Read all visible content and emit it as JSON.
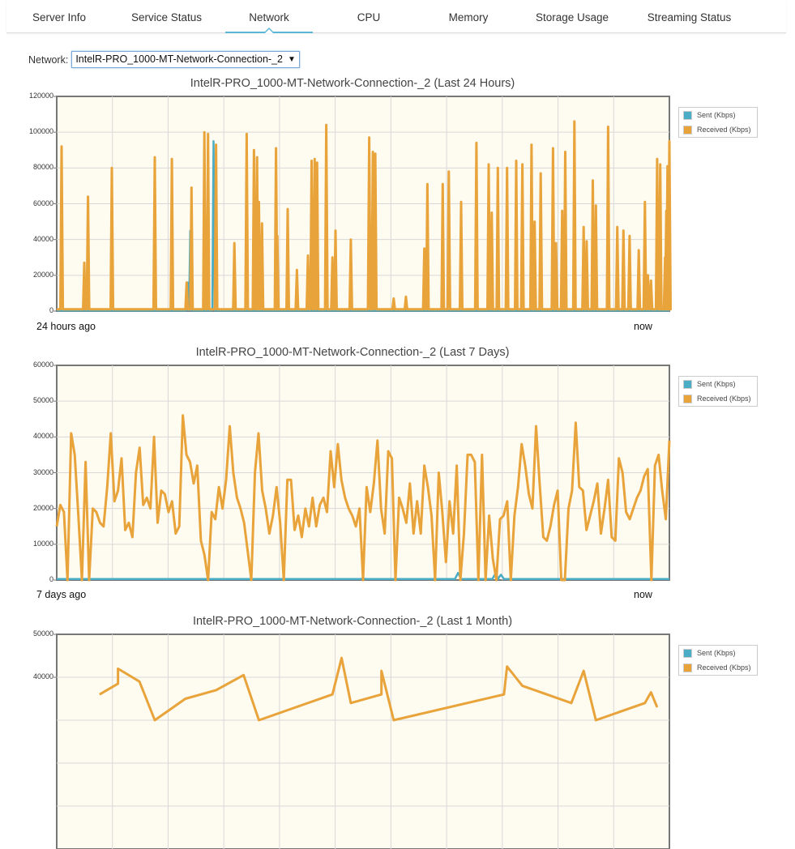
{
  "tabs": [
    {
      "label": "Server Info",
      "active": false
    },
    {
      "label": "Service Status",
      "active": false
    },
    {
      "label": "Network",
      "active": true
    },
    {
      "label": "CPU",
      "active": false
    },
    {
      "label": "Memory",
      "active": false
    },
    {
      "label": "Storage Usage",
      "active": false
    },
    {
      "label": "Streaming Status",
      "active": false
    }
  ],
  "network_selector": {
    "label": "Network:",
    "value": "IntelR-PRO_1000-MT-Network-Connection-_2"
  },
  "legend": {
    "sent": "Sent (Kbps)",
    "received": "Received (Kbps)"
  },
  "colors": {
    "sent": "#4bacc6",
    "received": "#e8a33a",
    "plot_bg": "#fefcf0",
    "grid": "#d8d8d8",
    "tab_accent": "#5ab6d4"
  },
  "chart_data": [
    {
      "type": "line",
      "title": "IntelR-PRO_1000-MT-Network-Connection-_2 (Last 24 Hours)",
      "start_label": "24 hours ago",
      "end_label": "now",
      "ylim": [
        0,
        120000
      ],
      "yticks": [
        0,
        20000,
        40000,
        60000,
        80000,
        100000,
        120000
      ],
      "grid": true,
      "legend_position": "right",
      "series": [
        {
          "name": "Sent (Kbps)",
          "key": "sent",
          "spikes": [
            [
              0.214,
              16000
            ],
            [
              0.218,
              45000
            ],
            [
              0.256,
              95000
            ]
          ],
          "baseline": 300
        },
        {
          "name": "Received (Kbps)",
          "key": "received",
          "baseline": 1000,
          "spikes": [
            [
              0.008,
              92000
            ],
            [
              0.045,
              27000
            ],
            [
              0.051,
              64000
            ],
            [
              0.09,
              80000
            ],
            [
              0.16,
              86000
            ],
            [
              0.188,
              85000
            ],
            [
              0.212,
              16000
            ],
            [
              0.22,
              69000
            ],
            [
              0.241,
              100000
            ],
            [
              0.247,
              99000
            ],
            [
              0.26,
              93000
            ],
            [
              0.29,
              38000
            ],
            [
              0.31,
              99000
            ],
            [
              0.322,
              90000
            ],
            [
              0.327,
              86000
            ],
            [
              0.33,
              61000
            ],
            [
              0.335,
              49000
            ],
            [
              0.358,
              91000
            ],
            [
              0.36,
              42000
            ],
            [
              0.377,
              57000
            ],
            [
              0.392,
              23000
            ],
            [
              0.41,
              31000
            ],
            [
              0.416,
              84000
            ],
            [
              0.421,
              85000
            ],
            [
              0.425,
              83000
            ],
            [
              0.44,
              104000
            ],
            [
              0.45,
              30000
            ],
            [
              0.455,
              45000
            ],
            [
              0.48,
              40000
            ],
            [
              0.51,
              97000
            ],
            [
              0.516,
              89000
            ],
            [
              0.52,
              88000
            ],
            [
              0.55,
              7000
            ],
            [
              0.57,
              8000
            ],
            [
              0.6,
              35000
            ],
            [
              0.605,
              71000
            ],
            [
              0.63,
              71000
            ],
            [
              0.64,
              78000
            ],
            [
              0.66,
              61000
            ],
            [
              0.685,
              94000
            ],
            [
              0.705,
              82000
            ],
            [
              0.71,
              55000
            ],
            [
              0.72,
              80000
            ],
            [
              0.735,
              80000
            ],
            [
              0.75,
              84000
            ],
            [
              0.76,
              82000
            ],
            [
              0.775,
              93000
            ],
            [
              0.78,
              50000
            ],
            [
              0.79,
              77000
            ],
            [
              0.81,
              91000
            ],
            [
              0.815,
              38000
            ],
            [
              0.825,
              56000
            ],
            [
              0.83,
              89000
            ],
            [
              0.845,
              106000
            ],
            [
              0.86,
              47000
            ],
            [
              0.865,
              39000
            ],
            [
              0.875,
              73000
            ],
            [
              0.88,
              59000
            ],
            [
              0.9,
              103000
            ],
            [
              0.915,
              47000
            ],
            [
              0.925,
              45000
            ],
            [
              0.935,
              42000
            ],
            [
              0.95,
              34000
            ],
            [
              0.96,
              61000
            ],
            [
              0.965,
              20000
            ],
            [
              0.97,
              17000
            ],
            [
              0.98,
              85000
            ],
            [
              0.985,
              82000
            ],
            [
              0.995,
              56000
            ],
            [
              1.0,
              95000
            ],
            [
              1.0,
              93000
            ],
            [
              0.997,
              81000
            ],
            [
              0.999,
              80000
            ],
            [
              0.993,
              30000
            ],
            [
              0.984,
              16000
            ]
          ]
        }
      ]
    },
    {
      "type": "line",
      "title": "IntelR-PRO_1000-MT-Network-Connection-_2 (Last 7 Days)",
      "start_label": "7 days ago",
      "end_label": "now",
      "ylim": [
        0,
        60000
      ],
      "yticks": [
        0,
        10000,
        20000,
        30000,
        40000,
        50000,
        60000
      ],
      "grid": true,
      "legend_position": "right",
      "series": [
        {
          "name": "Sent (Kbps)",
          "key": "sent",
          "baseline": 300,
          "bumps": [
            [
              0.36,
              300
            ],
            [
              0.5,
              400
            ],
            [
              0.655,
              2000
            ],
            [
              0.716,
              1800
            ],
            [
              0.725,
              1500
            ]
          ]
        },
        {
          "name": "Received (Kbps)",
          "key": "received",
          "values": [
            15000,
            21000,
            19000,
            0,
            41000,
            35000,
            18000,
            0,
            33000,
            0,
            20000,
            19000,
            16000,
            15000,
            26000,
            41000,
            22000,
            25000,
            34000,
            14000,
            16000,
            12000,
            30000,
            37000,
            21000,
            23000,
            20000,
            40000,
            16000,
            25000,
            24000,
            19000,
            22000,
            13000,
            15000,
            46000,
            35000,
            33000,
            27000,
            32000,
            11000,
            7000,
            0,
            19000,
            17000,
            26000,
            20000,
            28000,
            43000,
            30000,
            23000,
            20000,
            16000,
            8000,
            0,
            30000,
            41000,
            25000,
            20000,
            13000,
            18000,
            26000,
            16000,
            0,
            28000,
            28000,
            14000,
            18000,
            12000,
            20000,
            15000,
            23000,
            15000,
            21000,
            23000,
            19000,
            36000,
            26000,
            38000,
            28000,
            23000,
            20000,
            18000,
            15000,
            20000,
            0,
            26000,
            19000,
            27000,
            39000,
            20000,
            13000,
            36000,
            34000,
            0,
            23000,
            20000,
            16000,
            27000,
            13000,
            22000,
            13000,
            32000,
            26000,
            18000,
            0,
            30000,
            19000,
            5000,
            22000,
            13000,
            32000,
            0,
            13000,
            35000,
            35000,
            33000,
            0,
            35000,
            0,
            18000,
            6000,
            0,
            17000,
            18000,
            22000,
            0,
            18000,
            26000,
            38000,
            32000,
            24000,
            20000,
            43000,
            27000,
            12000,
            11000,
            15000,
            21000,
            25000,
            0,
            0,
            20000,
            25000,
            44000,
            26000,
            25000,
            14000,
            18000,
            22000,
            27000,
            13000,
            20000,
            28000,
            12000,
            11000,
            34000,
            30000,
            19000,
            17000,
            20000,
            23000,
            25000,
            29000,
            31000,
            0,
            32000,
            35000,
            25000,
            17000,
            39000
          ]
        }
      ]
    },
    {
      "type": "line",
      "title": "IntelR-PRO_1000-MT-Network-Connection-_2 (Last 1 Month)",
      "ylim": [
        0,
        50000
      ],
      "yticks": [
        40000,
        50000
      ],
      "grid": true,
      "legend_position": "right",
      "series": [
        {
          "name": "Sent (Kbps)",
          "key": "sent",
          "values": []
        },
        {
          "name": "Received (Kbps)",
          "key": "received",
          "values": [
            [
              0.07,
              36000
            ],
            [
              0.1,
              38500
            ],
            [
              0.1,
              42000
            ],
            [
              0.135,
              39000
            ],
            [
              0.16,
              30000
            ],
            [
              0.21,
              35000
            ],
            [
              0.26,
              37000
            ],
            [
              0.305,
              40500
            ],
            [
              0.33,
              30000
            ],
            [
              0.45,
              36000
            ],
            [
              0.465,
              44500
            ],
            [
              0.48,
              34000
            ],
            [
              0.53,
              36000
            ],
            [
              0.53,
              41500
            ],
            [
              0.55,
              30000
            ],
            [
              0.73,
              36000
            ],
            [
              0.735,
              42500
            ],
            [
              0.76,
              38000
            ],
            [
              0.84,
              34000
            ],
            [
              0.86,
              41500
            ],
            [
              0.88,
              30000
            ],
            [
              0.96,
              34000
            ],
            [
              0.97,
              36500
            ],
            [
              0.98,
              33000
            ]
          ]
        }
      ]
    }
  ]
}
